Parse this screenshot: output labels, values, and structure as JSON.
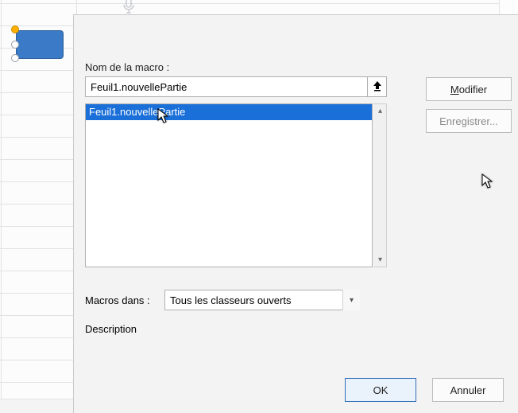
{
  "dialog": {
    "name_label": "Nom de la macro :",
    "name_value": "Feuil1.nouvellePartie",
    "list_selected": "Feuil1.nouvellePartie",
    "scope_label": "Macros dans :",
    "scope_value": "Tous les classeurs ouverts",
    "description_label": "Description",
    "buttons": {
      "modify": "Modifier",
      "record": "Enregistrer...",
      "ok": "OK",
      "cancel": "Annuler"
    }
  }
}
